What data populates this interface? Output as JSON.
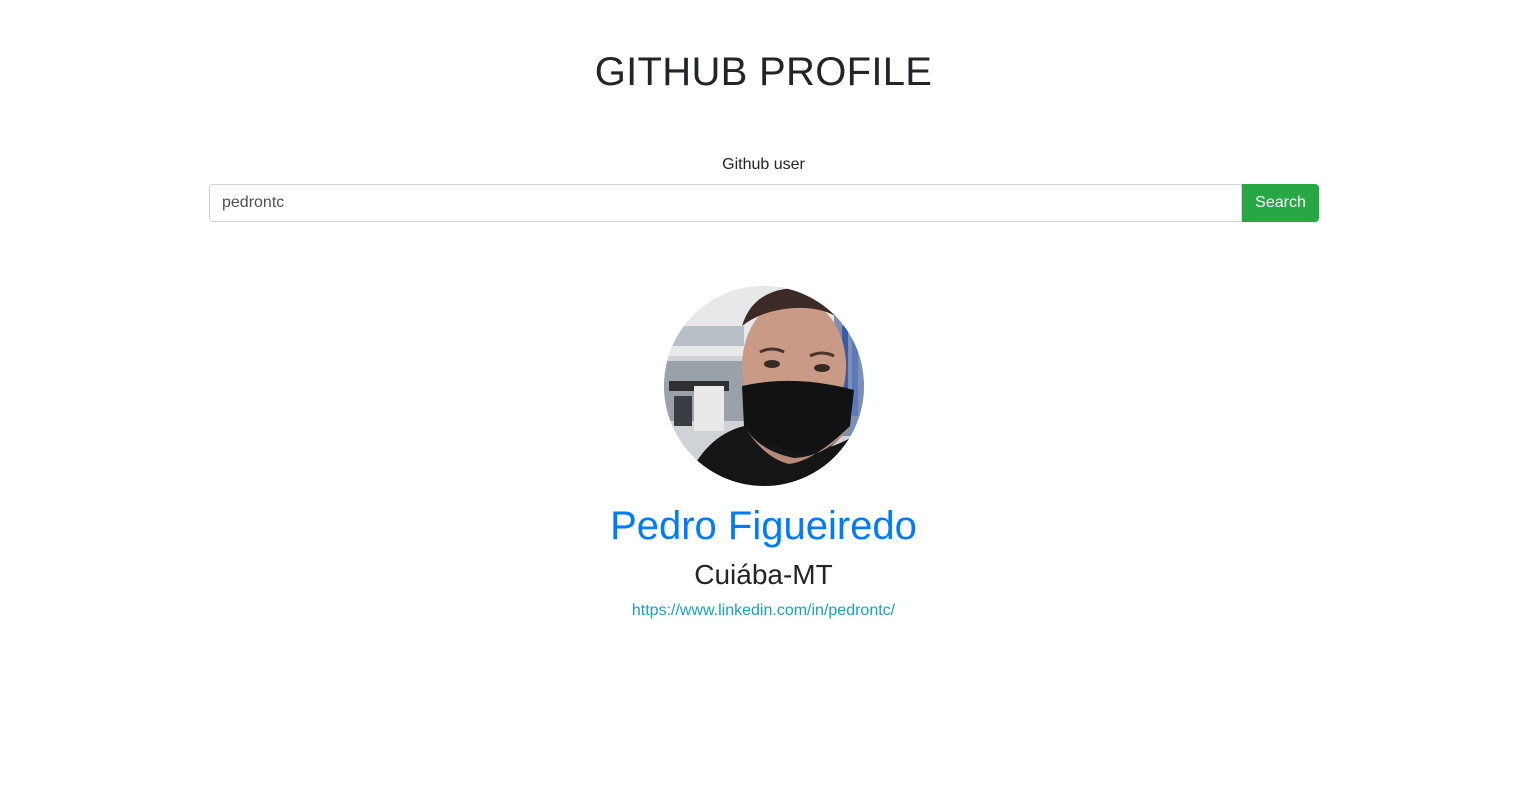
{
  "header": {
    "title": "GITHUB PROFILE"
  },
  "search": {
    "label": "Github user",
    "value": "pedrontc",
    "button_label": "Search",
    "button_color": "#28a745"
  },
  "profile": {
    "avatar_icon": "user-photo",
    "name": "Pedro Figueiredo",
    "location": "Cuiába-MT",
    "link": "https://www.linkedin.com/in/pedrontc/",
    "name_color": "#007bff",
    "link_color": "#17a2b8"
  }
}
